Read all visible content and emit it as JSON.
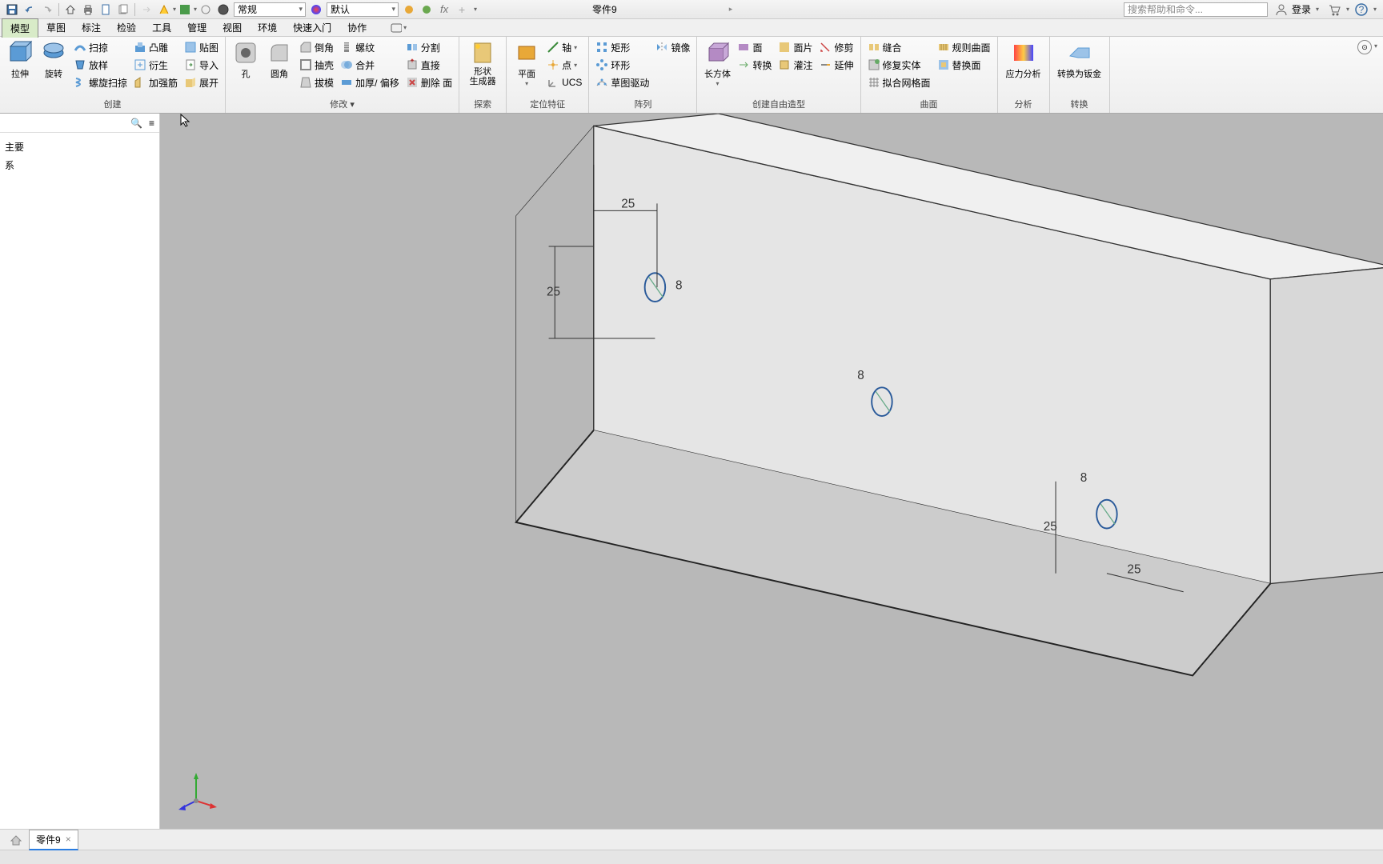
{
  "app": {
    "title": "零件9",
    "search_placeholder": "搜索帮助和命令...",
    "login": "登录"
  },
  "qat_combo1": "常规",
  "qat_combo2": "默认",
  "tabs": [
    "模型",
    "草图",
    "标注",
    "检验",
    "工具",
    "管理",
    "视图",
    "环境",
    "快速入门",
    "协作"
  ],
  "active_tab": 0,
  "ribbon": {
    "create": {
      "title": "创建",
      "extrude": "拉伸",
      "revolve": "旋转",
      "sweep": "扫掠",
      "loft": "放样",
      "coil": "螺旋扫掠",
      "emboss": "凸雕",
      "derive": "衍生",
      "rib": "加强筋",
      "decal": "贴图",
      "import": "导入",
      "unwrap": "展开"
    },
    "modify": {
      "title": "修改 ▾",
      "hole": "孔",
      "fillet": "圆角",
      "chamfer": "倒角",
      "shell": "抽壳",
      "draft": "拔模",
      "thread": "螺纹",
      "combine": "合并",
      "thicken": "加厚/ 偏移",
      "split": "分割",
      "direct": "直接",
      "delete": "删除 面"
    },
    "explore": {
      "title": "探索",
      "shape": "形状\n生成器"
    },
    "work": {
      "title": "定位特征",
      "plane": "平面",
      "axis": "轴",
      "point": "点",
      "ucs": "UCS"
    },
    "pattern": {
      "title": "阵列",
      "rect": "矩形",
      "circ": "环形",
      "sketch": "草图驱动",
      "mirror": "镜像"
    },
    "freeform": {
      "title": "创建自由造型",
      "box": "长方体",
      "face": "面",
      "convert": "转换",
      "plane2": "面片",
      "fillg": "灌注",
      "trim": "修剪",
      "extend": "延伸"
    },
    "surface": {
      "title": "曲面",
      "stitch": "缝合",
      "ruled": "规则曲面",
      "replace": "替换面",
      "repair": "修复实体",
      "fit": "拟合网格面"
    },
    "analysis": {
      "title": "分析",
      "stress": "应力分析"
    },
    "convert": {
      "title": "转换",
      "sheet": "转换为钣金"
    }
  },
  "browser": {
    "item1": "主要",
    "item2": "系"
  },
  "doctab": "零件9",
  "dims": {
    "d1": "25",
    "d2": "25",
    "d3": "8",
    "d4": "8",
    "d5": "25",
    "d6": "25"
  }
}
